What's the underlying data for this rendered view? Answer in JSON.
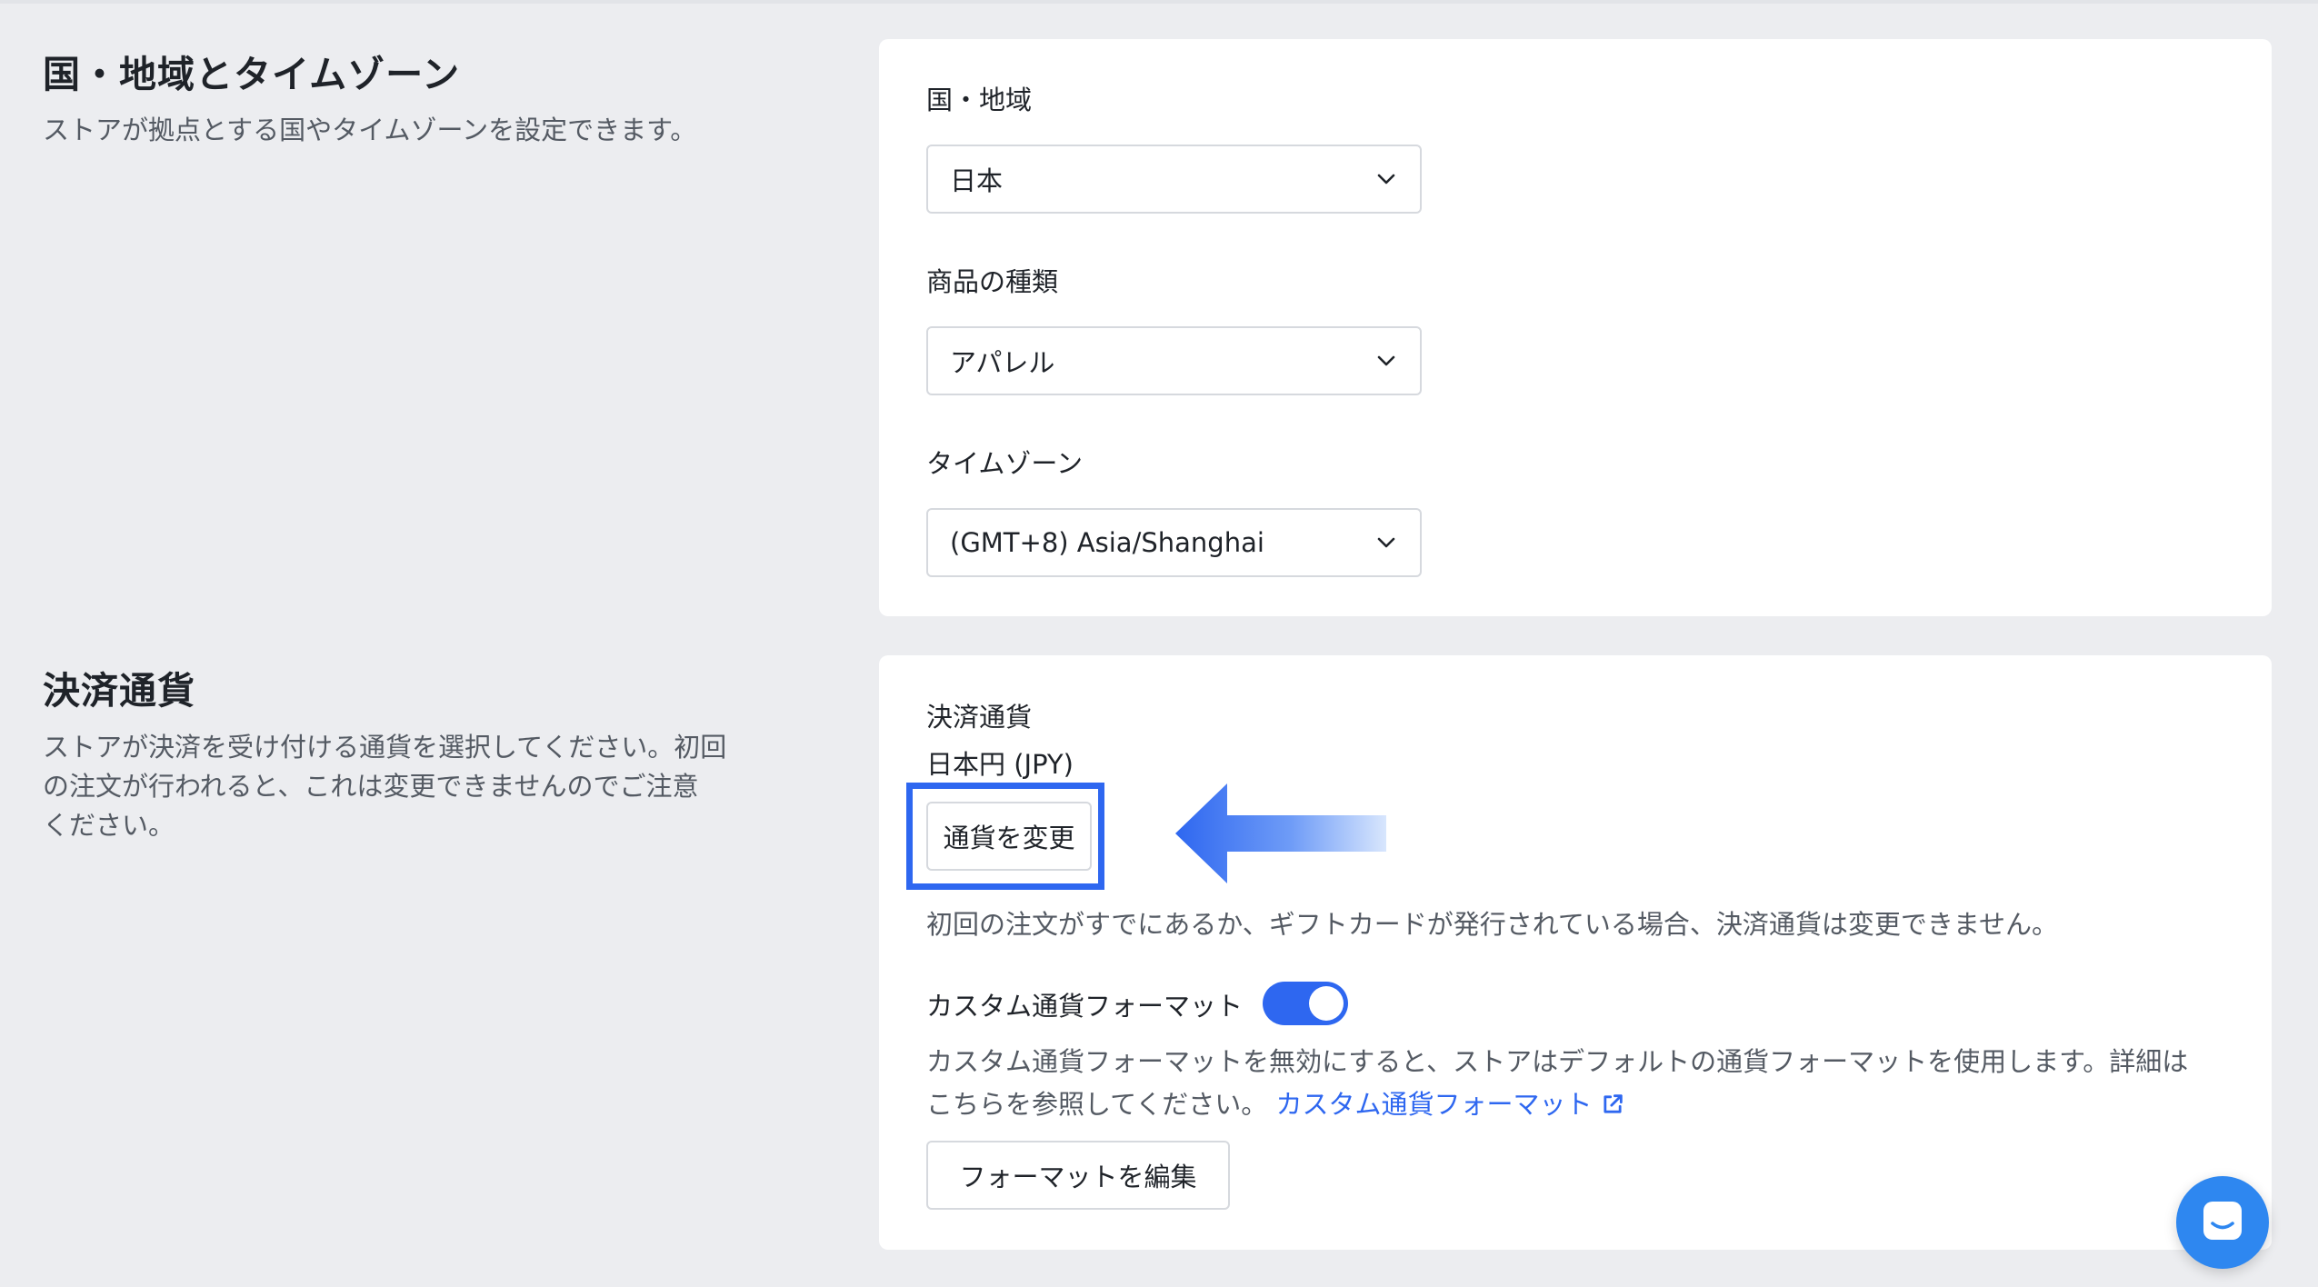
{
  "region_section": {
    "title": "国・地域とタイムゾーン",
    "description": "ストアが拠点とする国やタイムゾーンを設定できます。",
    "country": {
      "label": "国・地域",
      "value": "日本"
    },
    "product_type": {
      "label": "商品の種類",
      "value": "アパレル"
    },
    "timezone": {
      "label": "タイムゾーン",
      "value": "(GMT+8) Asia/Shanghai"
    }
  },
  "currency_section": {
    "title": "決済通貨",
    "description_lines": [
      "ストアが決済を受け付ける通貨を選択してください。初回",
      "の注文が行われると、これは変更できませんのでご注意",
      "ください。"
    ],
    "currency_label": "決済通貨",
    "currency_value": "日本円 (JPY)",
    "change_button": "通貨を変更",
    "note": "初回の注文がすでにあるか、ギフトカードが発行されている場合、決済通貨は変更できません。",
    "custom_format": {
      "label": "カスタム通貨フォーマット",
      "enabled": true,
      "description_line1": "カスタム通貨フォーマットを無効にすると、ストアはデフォルトの通貨フォーマットを使用します。詳細は",
      "description_line2": "こちらを参照してください。",
      "link_text": "カスタム通貨フォーマット",
      "edit_button": "フォーマットを編集"
    }
  },
  "colors": {
    "accent": "#2e67f0",
    "background": "#ecedf0",
    "chat": "#2e87f0"
  },
  "icons": {
    "select_chevron": "chevron-down-icon",
    "external_link": "external-link-icon",
    "chat": "chat-icon",
    "annotation_arrow": "arrow-left-icon"
  }
}
